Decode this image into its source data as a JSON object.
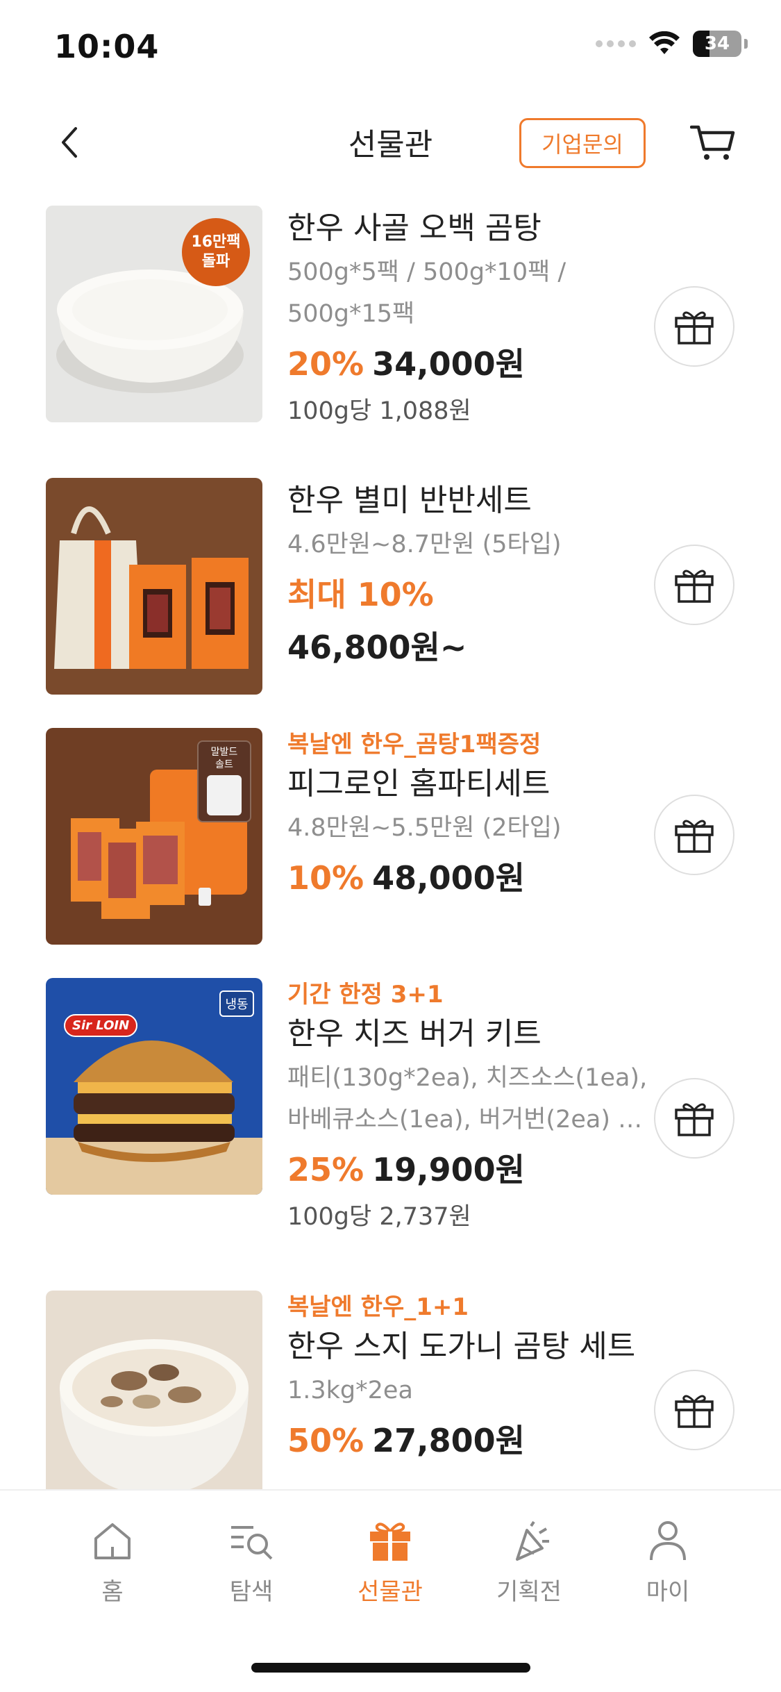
{
  "status_bar": {
    "time": "10:04",
    "battery": "34",
    "battery_level": 0.34
  },
  "header": {
    "title": "선물관",
    "corp_inquiry_label": "기업문의"
  },
  "products": [
    {
      "promo": "",
      "name": "한우 사골 오백 곰탕",
      "options_line1": "500g*5팩 / 500g*10팩 /",
      "options_line2": "500g*15팩",
      "discount": "20%",
      "price": "34,000원",
      "unit_price": "100g당 1,088원",
      "badge_line1": "16만팩",
      "badge_line2": "돌파"
    },
    {
      "promo": "",
      "name": "한우 별미 반반세트",
      "options_line1": "4.6만원~8.7만원 (5타입)",
      "discount": "최대 10%",
      "price": "46,800원~"
    },
    {
      "promo": "복날엔 한우_곰탕1팩증정",
      "name": "피그로인 홈파티세트",
      "options_line1": "4.8만원~5.5만원 (2타입)",
      "discount": "10%",
      "price": "48,000원",
      "tag_line1": "말발드",
      "tag_line2": "솔트"
    },
    {
      "promo": "기간 한정 3+1",
      "name": "한우 치즈 버거 키트",
      "options_line1": "패티(130g*2ea), 치즈소스(1ea),",
      "options_line2": "바베큐소스(1ea), 버거번(2ea) …",
      "discount": "25%",
      "price": "19,900원",
      "unit_price": "100g당 2,737원",
      "frozen_tag": "냉동",
      "logo_text": "Sir LOIN"
    },
    {
      "promo": "복날엔 한우_1+1",
      "name": "한우 스지 도가니 곰탕 세트",
      "options_line1": "1.3kg*2ea",
      "discount": "50%",
      "price": "27,800원"
    }
  ],
  "bottom_nav": {
    "items": [
      {
        "label": "홈",
        "icon": "home-icon",
        "active": false
      },
      {
        "label": "탐색",
        "icon": "search-list-icon",
        "active": false
      },
      {
        "label": "선물관",
        "icon": "gift-icon",
        "active": true
      },
      {
        "label": "기획전",
        "icon": "party-icon",
        "active": false
      },
      {
        "label": "마이",
        "icon": "person-icon",
        "active": false
      }
    ]
  },
  "colors": {
    "accent": "#ef7a2c",
    "text": "#1f1f1f",
    "muted": "#8e8e8e"
  }
}
